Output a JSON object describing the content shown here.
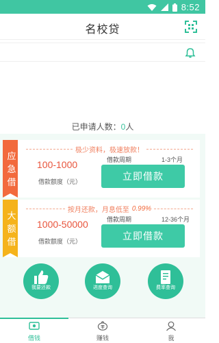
{
  "status": {
    "time": "8:52",
    "icons": [
      "wifi-icon",
      "signal-icon",
      "battery-icon"
    ]
  },
  "header": {
    "title": "名校贷",
    "scan_icon": "qr-scan-icon"
  },
  "notice": {
    "bell_icon": "bell-icon"
  },
  "applicants": {
    "prefix": "已申请人数：",
    "count": "0",
    "suffix": "人"
  },
  "loans": [
    {
      "tag": "应急借",
      "slogan": "极少资料，极速放款！",
      "rate": "",
      "amount": "100-1000",
      "amount_label": "借款额度（元）",
      "term_label": "借款周期",
      "term": "1-3个月",
      "button": "立即借款",
      "tag_color": "#f26a3d"
    },
    {
      "tag": "大额借",
      "slogan": "按月还款，月息低至",
      "rate": "0.99%",
      "amount": "1000-50000",
      "amount_label": "借款额度（元）",
      "term_label": "借款周期",
      "term": "12-36个月",
      "button": "立即借款",
      "tag_color": "#f5b31b"
    }
  ],
  "shortcuts": [
    {
      "label": "我要还款",
      "icon": "thumbs-up-icon"
    },
    {
      "label": "进度查询",
      "icon": "envelope-icon"
    },
    {
      "label": "费率查询",
      "icon": "document-icon"
    }
  ],
  "tabs": [
    {
      "label": "借钱",
      "icon": "money-icon",
      "active": true
    },
    {
      "label": "赚钱",
      "icon": "coin-bag-icon",
      "active": false
    },
    {
      "label": "我",
      "icon": "user-icon",
      "active": false
    }
  ],
  "colors": {
    "accent": "#3ecaa6",
    "status_bar": "#40c6a2",
    "amount": "#e8543c"
  }
}
